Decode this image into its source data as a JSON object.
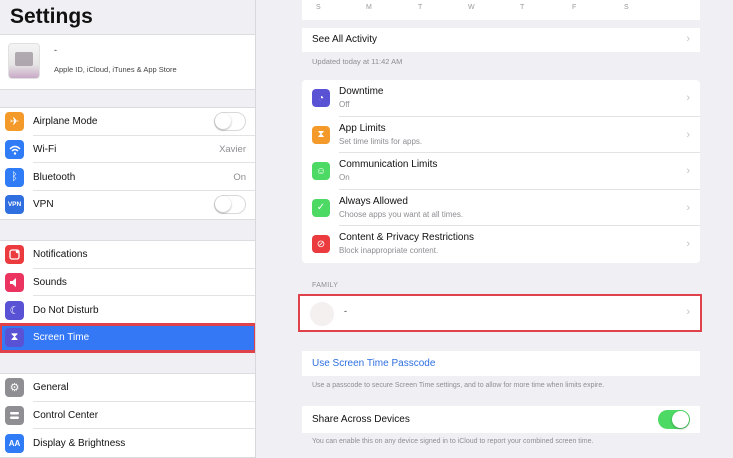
{
  "sidebar": {
    "title": "Settings",
    "profile": {
      "name": "-",
      "subtitle": "Apple ID, iCloud, iTunes & App Store"
    },
    "group1": [
      {
        "label": "Airplane Mode",
        "icon": "airplane-icon",
        "color": "#f39a2b",
        "glyph": "✈",
        "toggle": false
      },
      {
        "label": "Wi-Fi",
        "icon": "wifi-icon",
        "color": "#2f7cf6",
        "glyph": "≋",
        "value": "Xavier"
      },
      {
        "label": "Bluetooth",
        "icon": "bluetooth-icon",
        "color": "#2f7cf6",
        "glyph": "ᛒ",
        "value": "On"
      },
      {
        "label": "VPN",
        "icon": "vpn-icon",
        "color": "#2f6fe0",
        "glyph": "VPN",
        "toggle": false
      }
    ],
    "group2": [
      {
        "label": "Notifications",
        "icon": "notifications-icon",
        "color": "#eb3b3f",
        "glyph": "▣"
      },
      {
        "label": "Sounds",
        "icon": "sounds-icon",
        "color": "#eb3560",
        "glyph": "◀"
      },
      {
        "label": "Do Not Disturb",
        "icon": "moon-icon",
        "color": "#5a52d4",
        "glyph": "☾"
      },
      {
        "label": "Screen Time",
        "icon": "hourglass-icon",
        "color": "#5a52d4",
        "glyph": "⧗",
        "selected": true
      }
    ],
    "group3": [
      {
        "label": "General",
        "icon": "gear-icon",
        "color": "#8e8e93",
        "glyph": "⚙"
      },
      {
        "label": "Control Center",
        "icon": "control-center-icon",
        "color": "#8e8e93",
        "glyph": "☰"
      },
      {
        "label": "Display & Brightness",
        "icon": "display-icon",
        "color": "#2f7cf6",
        "glyph": "AA"
      }
    ]
  },
  "main": {
    "chart_days": [
      "S",
      "M",
      "T",
      "W",
      "T",
      "F",
      "S"
    ],
    "see_all_activity": "See All Activity",
    "updated": "Updated today at 11:42 AM",
    "items": [
      {
        "title": "Downtime",
        "subtitle": "Off",
        "icon": "downtime-icon",
        "color": "#5a52d4",
        "glyph": "◔"
      },
      {
        "title": "App Limits",
        "subtitle": "Set time limits for apps.",
        "icon": "hourglass-icon",
        "color": "#f39a2b",
        "glyph": "⧗"
      },
      {
        "title": "Communication Limits",
        "subtitle": "On",
        "icon": "communication-icon",
        "color": "#4cd964",
        "glyph": "☺"
      },
      {
        "title": "Always Allowed",
        "subtitle": "Choose apps you want at all times.",
        "icon": "checkmark-icon",
        "color": "#4cd964",
        "glyph": "✓"
      },
      {
        "title": "Content & Privacy Restrictions",
        "subtitle": "Block inappropriate content.",
        "icon": "restriction-icon",
        "color": "#eb3b3f",
        "glyph": "⊘"
      }
    ],
    "family_header": "FAMILY",
    "family_member": "-",
    "passcode_label": "Use Screen Time Passcode",
    "passcode_note": "Use a passcode to secure Screen Time settings, and to allow for more time when limits expire.",
    "share_label": "Share Across Devices",
    "share_on": true,
    "share_note": "You can enable this on any device signed in to iCloud to report your combined screen time."
  }
}
